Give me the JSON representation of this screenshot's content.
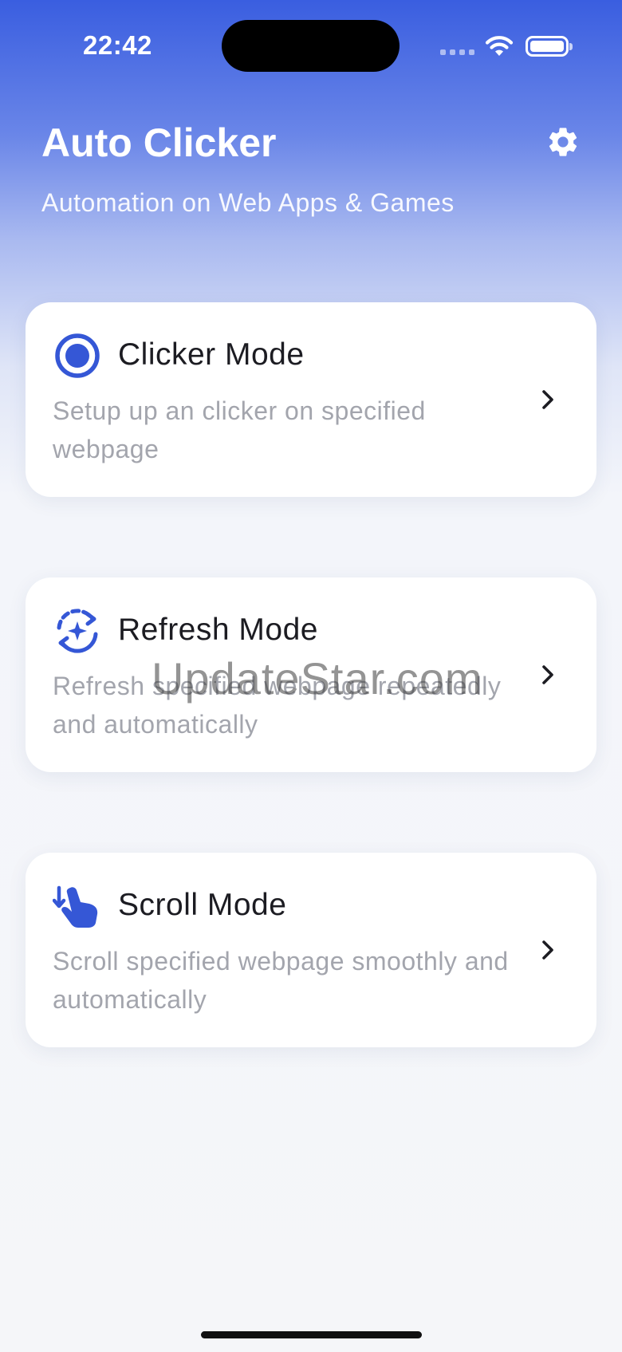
{
  "status_bar": {
    "time": "22:42"
  },
  "header": {
    "title": "Auto Clicker",
    "subtitle": "Automation on Web Apps & Games",
    "settings_icon": "gear-icon"
  },
  "modes": [
    {
      "title": "Clicker Mode",
      "description": "Setup up an clicker on specified webpage",
      "icon": "target-icon"
    },
    {
      "title": "Refresh Mode",
      "description": "Refresh specified webpage repeatedly and automatically",
      "icon": "refresh-sparkle-icon"
    },
    {
      "title": "Scroll Mode",
      "description": "Scroll specified webpage smoothly and automatically",
      "icon": "scroll-hand-icon"
    }
  ],
  "watermark": "UpdateStar.com",
  "colors": {
    "accent": "#3557d6",
    "header_top": "#3a5ee0",
    "card_bg": "#ffffff",
    "desc_text": "#a3a5ad"
  }
}
